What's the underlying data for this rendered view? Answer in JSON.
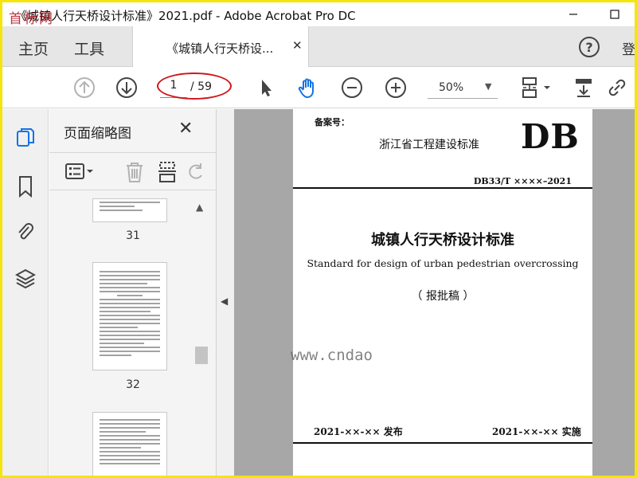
{
  "window": {
    "title": "《城镇人行天桥设计标准》2021.pdf - Adobe Acrobat Pro DC",
    "watermark_logo": "首标网"
  },
  "tabs": {
    "home": "主页",
    "tools": "工具",
    "document": "《城镇人行天桥设...",
    "signin": "登"
  },
  "toolbar": {
    "page_current": "1",
    "page_total": "/ 59",
    "zoom": "50%"
  },
  "left_rail": {
    "items": [
      "page-thumbnails-icon",
      "bookmark-icon",
      "attachment-icon",
      "layers-icon"
    ]
  },
  "thumbnail_panel": {
    "title": "页面缩略图",
    "pages": [
      "31",
      "32"
    ]
  },
  "document_page": {
    "record_no": "备案号：",
    "org": "浙江省工程建设标准",
    "mark": "DB",
    "std_number": "DB33/T ××××–2021",
    "title_cn": "城镇人行天桥设计标准",
    "title_en": "Standard for design of urban pedestrian overcrossing",
    "draft": "（ 报批稿 ）",
    "issue": "2021-××-××  发布",
    "implement": "2021-××-××  实施"
  },
  "watermark_site": "www.cndao",
  "colors": {
    "border_yellow": "#f5e50a",
    "annotation_red": "#d0171b",
    "hand_blue": "#1473e6"
  }
}
